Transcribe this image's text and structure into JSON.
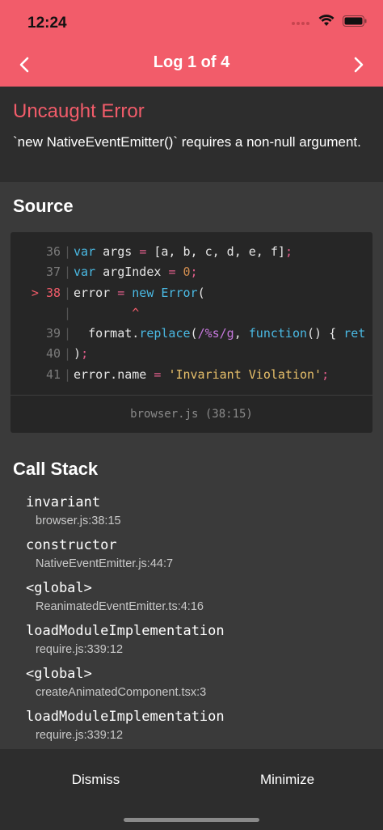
{
  "status_bar": {
    "time": "12:24"
  },
  "nav": {
    "title": "Log 1 of 4"
  },
  "error": {
    "title": "Uncaught Error",
    "message": "`new NativeEventEmitter()` requires a non-null argument."
  },
  "source": {
    "title": "Source",
    "lines": [
      {
        "num": "36",
        "marker": "",
        "code": "var args = [a, b, c, d, e, f];"
      },
      {
        "num": "37",
        "marker": "",
        "code": "var argIndex = 0;"
      },
      {
        "num": "38",
        "marker": ">",
        "code": "error = new Error("
      },
      {
        "num": "",
        "marker": "",
        "code": "        ^"
      },
      {
        "num": "39",
        "marker": "",
        "code": "  format.replace(/%s/g, function() { ret"
      },
      {
        "num": "40",
        "marker": "",
        "code": ");"
      },
      {
        "num": "41",
        "marker": "",
        "code": "error.name = 'Invariant Violation';"
      }
    ],
    "location": "browser.js (38:15)"
  },
  "call_stack": {
    "title": "Call Stack",
    "frames": [
      {
        "fn": "invariant",
        "file": "browser.js:38:15"
      },
      {
        "fn": "constructor",
        "file": "NativeEventEmitter.js:44:7"
      },
      {
        "fn": "<global>",
        "file": "ReanimatedEventEmitter.ts:4:16"
      },
      {
        "fn": "loadModuleImplementation",
        "file": "require.js:339:12"
      },
      {
        "fn": "<global>",
        "file": "createAnimatedComponent.tsx:3"
      },
      {
        "fn": "loadModuleImplementation",
        "file": "require.js:339:12"
      }
    ]
  },
  "footer": {
    "dismiss_label": "Dismiss",
    "minimize_label": "Minimize"
  },
  "colors": {
    "accent": "#f25c6a",
    "background": "#3a3a3a",
    "panel": "#2d2d2d"
  }
}
